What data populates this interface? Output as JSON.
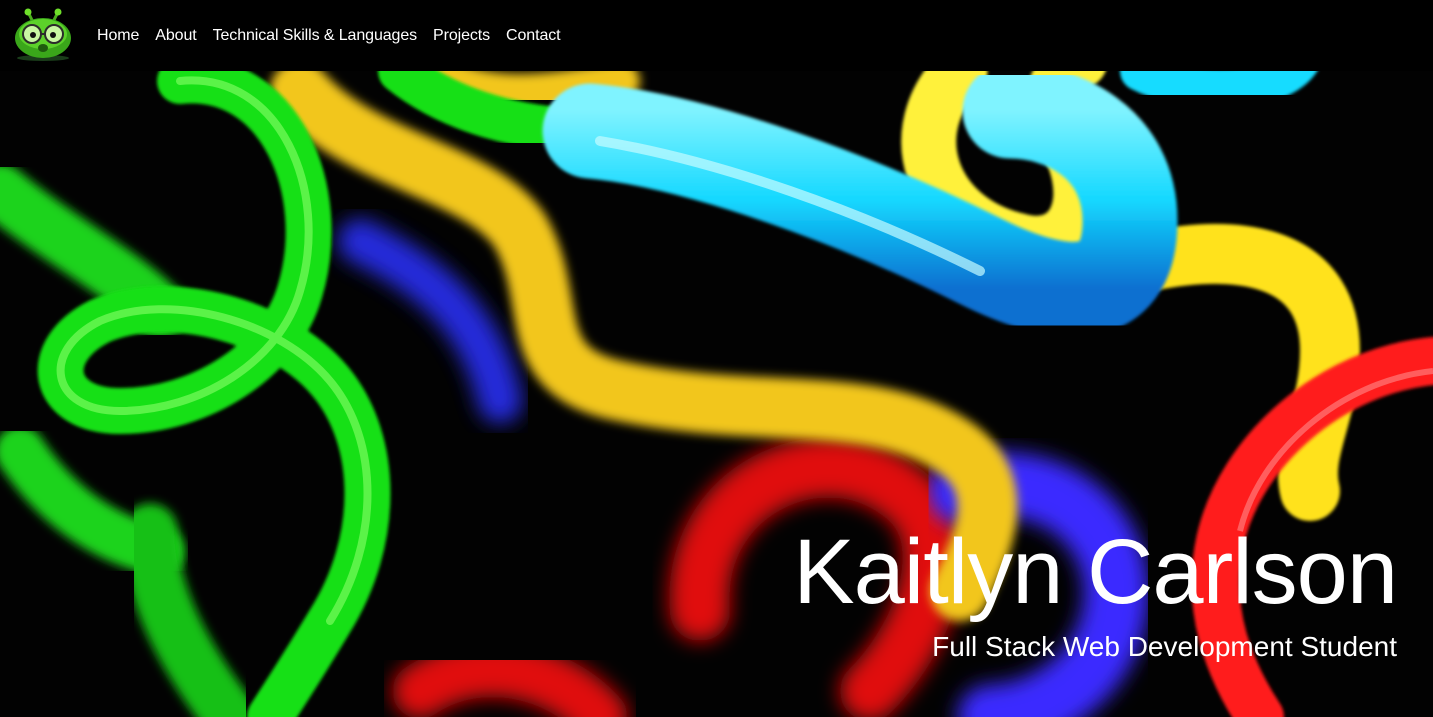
{
  "nav": {
    "logo_icon": "alien-logo-icon",
    "links": [
      {
        "label": "Home"
      },
      {
        "label": "About"
      },
      {
        "label": "Technical Skills & Languages"
      },
      {
        "label": "Projects"
      },
      {
        "label": "Contact"
      }
    ]
  },
  "hero": {
    "background": "neon-tubes-image",
    "title": "Kaitlyn Carlson",
    "subtitle": "Full Stack Web Development Student"
  },
  "colors": {
    "nav_bg": "#000000",
    "text": "#ffffff",
    "neon_green": "#22ff22",
    "neon_yellow": "#ffd21a",
    "neon_cyan": "#17e3ff",
    "neon_red": "#ff1a1a",
    "neon_blue": "#2a33ff"
  }
}
